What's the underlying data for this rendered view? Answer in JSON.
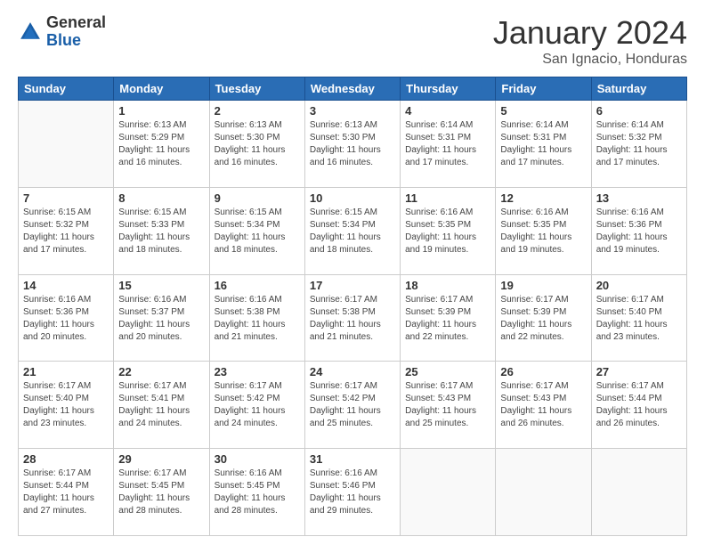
{
  "logo": {
    "general": "General",
    "blue": "Blue"
  },
  "header": {
    "month": "January 2024",
    "location": "San Ignacio, Honduras"
  },
  "weekdays": [
    "Sunday",
    "Monday",
    "Tuesday",
    "Wednesday",
    "Thursday",
    "Friday",
    "Saturday"
  ],
  "weeks": [
    [
      {
        "day": "",
        "info": ""
      },
      {
        "day": "1",
        "info": "Sunrise: 6:13 AM\nSunset: 5:29 PM\nDaylight: 11 hours and 16 minutes."
      },
      {
        "day": "2",
        "info": "Sunrise: 6:13 AM\nSunset: 5:30 PM\nDaylight: 11 hours and 16 minutes."
      },
      {
        "day": "3",
        "info": "Sunrise: 6:13 AM\nSunset: 5:30 PM\nDaylight: 11 hours and 16 minutes."
      },
      {
        "day": "4",
        "info": "Sunrise: 6:14 AM\nSunset: 5:31 PM\nDaylight: 11 hours and 17 minutes."
      },
      {
        "day": "5",
        "info": "Sunrise: 6:14 AM\nSunset: 5:31 PM\nDaylight: 11 hours and 17 minutes."
      },
      {
        "day": "6",
        "info": "Sunrise: 6:14 AM\nSunset: 5:32 PM\nDaylight: 11 hours and 17 minutes."
      }
    ],
    [
      {
        "day": "7",
        "info": "Sunrise: 6:15 AM\nSunset: 5:32 PM\nDaylight: 11 hours and 17 minutes."
      },
      {
        "day": "8",
        "info": "Sunrise: 6:15 AM\nSunset: 5:33 PM\nDaylight: 11 hours and 18 minutes."
      },
      {
        "day": "9",
        "info": "Sunrise: 6:15 AM\nSunset: 5:34 PM\nDaylight: 11 hours and 18 minutes."
      },
      {
        "day": "10",
        "info": "Sunrise: 6:15 AM\nSunset: 5:34 PM\nDaylight: 11 hours and 18 minutes."
      },
      {
        "day": "11",
        "info": "Sunrise: 6:16 AM\nSunset: 5:35 PM\nDaylight: 11 hours and 19 minutes."
      },
      {
        "day": "12",
        "info": "Sunrise: 6:16 AM\nSunset: 5:35 PM\nDaylight: 11 hours and 19 minutes."
      },
      {
        "day": "13",
        "info": "Sunrise: 6:16 AM\nSunset: 5:36 PM\nDaylight: 11 hours and 19 minutes."
      }
    ],
    [
      {
        "day": "14",
        "info": "Sunrise: 6:16 AM\nSunset: 5:36 PM\nDaylight: 11 hours and 20 minutes."
      },
      {
        "day": "15",
        "info": "Sunrise: 6:16 AM\nSunset: 5:37 PM\nDaylight: 11 hours and 20 minutes."
      },
      {
        "day": "16",
        "info": "Sunrise: 6:16 AM\nSunset: 5:38 PM\nDaylight: 11 hours and 21 minutes."
      },
      {
        "day": "17",
        "info": "Sunrise: 6:17 AM\nSunset: 5:38 PM\nDaylight: 11 hours and 21 minutes."
      },
      {
        "day": "18",
        "info": "Sunrise: 6:17 AM\nSunset: 5:39 PM\nDaylight: 11 hours and 22 minutes."
      },
      {
        "day": "19",
        "info": "Sunrise: 6:17 AM\nSunset: 5:39 PM\nDaylight: 11 hours and 22 minutes."
      },
      {
        "day": "20",
        "info": "Sunrise: 6:17 AM\nSunset: 5:40 PM\nDaylight: 11 hours and 23 minutes."
      }
    ],
    [
      {
        "day": "21",
        "info": "Sunrise: 6:17 AM\nSunset: 5:40 PM\nDaylight: 11 hours and 23 minutes."
      },
      {
        "day": "22",
        "info": "Sunrise: 6:17 AM\nSunset: 5:41 PM\nDaylight: 11 hours and 24 minutes."
      },
      {
        "day": "23",
        "info": "Sunrise: 6:17 AM\nSunset: 5:42 PM\nDaylight: 11 hours and 24 minutes."
      },
      {
        "day": "24",
        "info": "Sunrise: 6:17 AM\nSunset: 5:42 PM\nDaylight: 11 hours and 25 minutes."
      },
      {
        "day": "25",
        "info": "Sunrise: 6:17 AM\nSunset: 5:43 PM\nDaylight: 11 hours and 25 minutes."
      },
      {
        "day": "26",
        "info": "Sunrise: 6:17 AM\nSunset: 5:43 PM\nDaylight: 11 hours and 26 minutes."
      },
      {
        "day": "27",
        "info": "Sunrise: 6:17 AM\nSunset: 5:44 PM\nDaylight: 11 hours and 26 minutes."
      }
    ],
    [
      {
        "day": "28",
        "info": "Sunrise: 6:17 AM\nSunset: 5:44 PM\nDaylight: 11 hours and 27 minutes."
      },
      {
        "day": "29",
        "info": "Sunrise: 6:17 AM\nSunset: 5:45 PM\nDaylight: 11 hours and 28 minutes."
      },
      {
        "day": "30",
        "info": "Sunrise: 6:16 AM\nSunset: 5:45 PM\nDaylight: 11 hours and 28 minutes."
      },
      {
        "day": "31",
        "info": "Sunrise: 6:16 AM\nSunset: 5:46 PM\nDaylight: 11 hours and 29 minutes."
      },
      {
        "day": "",
        "info": ""
      },
      {
        "day": "",
        "info": ""
      },
      {
        "day": "",
        "info": ""
      }
    ]
  ]
}
